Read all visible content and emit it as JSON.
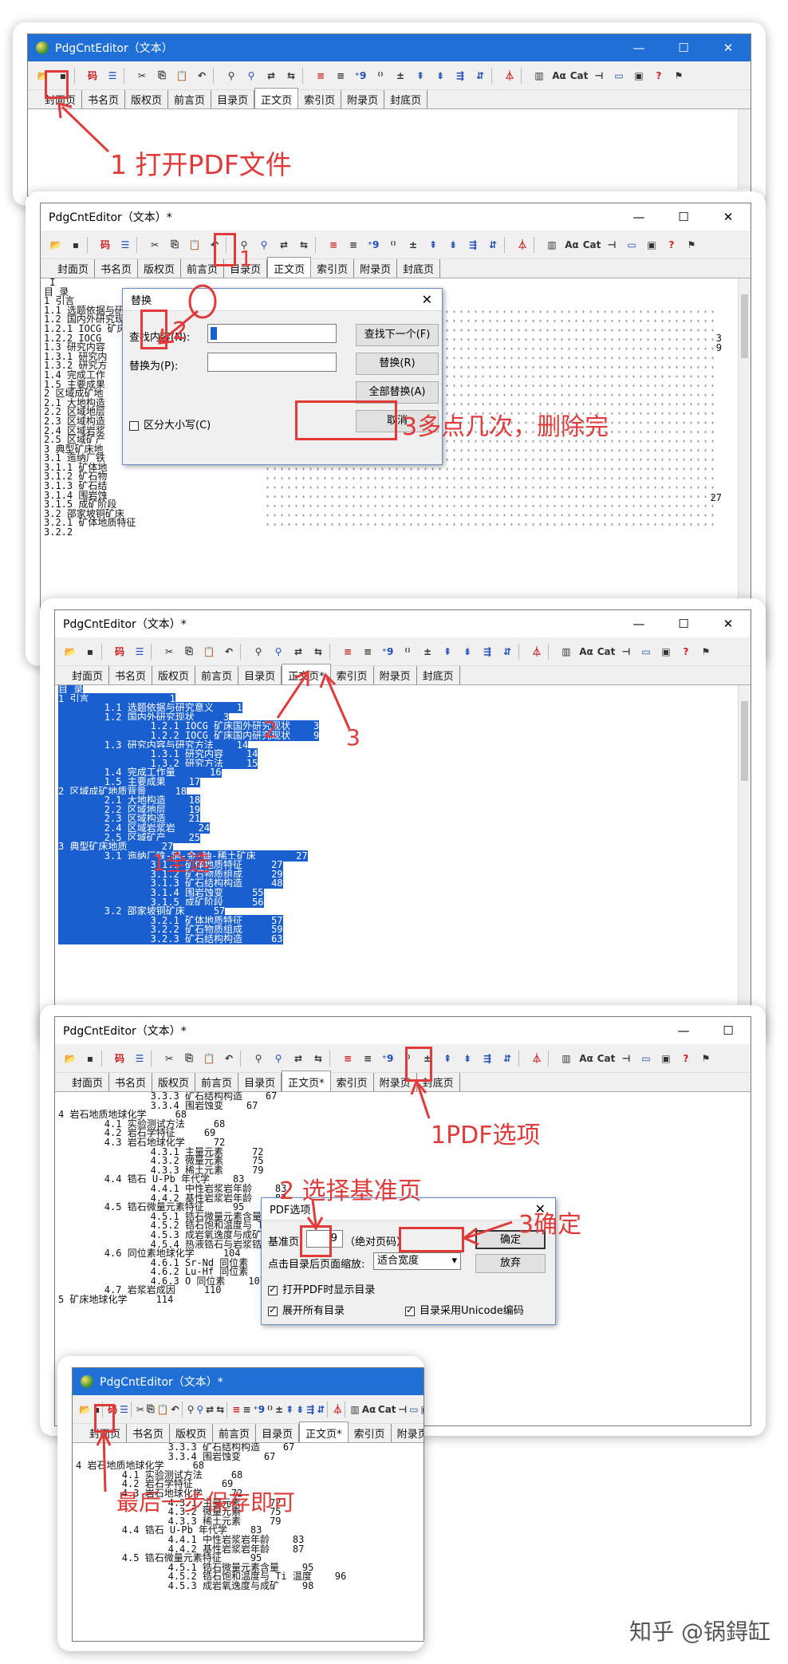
{
  "accent": "#e03a3a",
  "titlebar_blue": "#1f6fd6",
  "selection_blue": "#1a5fd0",
  "window_controls": [
    "—",
    "☐",
    "✕"
  ],
  "tabs": [
    "封面页",
    "书名页",
    "版权页",
    "前言页",
    "目录页",
    "正文页",
    "索引页",
    "附录页",
    "封底页"
  ],
  "tab_body_modified": "正文页*",
  "panel1": {
    "title": "PdgCntEditor（文本）",
    "annotation": "1 打开PDF文件"
  },
  "panel2": {
    "title": "PdgCntEditor（文本）*",
    "annotation1": "1",
    "annotation2": "2",
    "annotation3": "3多点几次，删除完",
    "lines": [
      " I",
      "目 录",
      "1 引言",
      "1.1 选题依据与研究意义 ",
      "1.2 国内外研究现状",
      "1.2.1 IOCG 矿床国外研究现状",
      "1.2.2 IOCG",
      "1.3 研究内容",
      "1.3.1 研究内",
      "1.3.2 研究方",
      "1.4 完成工作",
      "1.5 主要成果",
      "2 区域成矿地",
      "2.1 大地构造",
      "2.2 区域地层",
      "2.3 区域构造",
      "2.4 区域岩浆",
      "2.5 区域矿产",
      "3 典型矿床地",
      "3.1 迤纳厂铁",
      "3.1.1 矿体地",
      "3.1.2 矿石物",
      "3.1.3 矿石结",
      "3.1.4 围岩蚀",
      "3.1.5 成矿阶段",
      "3.2 邵家坡铜矿床",
      "3.2.1 矿体地质特征",
      "3.2.2"
    ],
    "right_numbers": [
      "3",
      "9",
      "27"
    ],
    "dialog": {
      "title": "替换",
      "find_label": "查找内容(N):",
      "find_value": "",
      "replace_label": "替换为(P):",
      "replace_value": "",
      "find_next": "查找下一个(F)",
      "replace": "替换(R)",
      "replace_all": "全部替换(A)",
      "cancel": "取消",
      "match_case": "区分大小写(C)"
    }
  },
  "panel3": {
    "title": "PdgCntEditor（文本）*",
    "annotation_select_all": "1全选",
    "annotation2": "2",
    "annotation3": "3",
    "lines": [
      "目 录",
      "1 引言              1",
      "        1.1 选题依据与研究意义    1",
      "        1.2 国内外研究现状     3",
      "                1.2.1 IOCG 矿床国外研究现状    3",
      "                1.2.2 IOCG 矿床国内研究现状    9",
      "        1.3 研究内容与研究方法    14",
      "                1.3.1 研究内容    14",
      "                1.3.2 研究方法    15",
      "        1.4 完成工作量      16",
      "        1.5 主要成果    17",
      "2 区域成矿地质背景     18",
      "        2.1 大地构造    18",
      "        2.2 区域地层    19",
      "        2.3 区域构造    21",
      "        2.4 区域岩浆岩    24",
      "        2.5 区域矿产    25",
      "3 典型矿床地质      27",
      "        3.1 迤纳厂铁-铜-金-铀-稀土矿床       27",
      "                3.1.1 矿体地质特征     27",
      "                3.1.2 矿石物质组成     29",
      "                3.1.3 矿石结构构造     48",
      "                3.1.4 围岩蚀变     55",
      "                3.1.5 成矿阶段     56",
      "        3.2 邵家坡铜矿床     57",
      "                3.2.1 矿体地质特征     57",
      "                3.2.2 矿石物质组成     59",
      "                3.2.3 矿石结构构造     63"
    ]
  },
  "panel4": {
    "title": "PdgCntEditor（文本）*",
    "annotation1": "1PDF选项",
    "annotation2": "2 选择基准页",
    "annotation3": "3确定",
    "lines": [
      "                3.3.3 矿石结构构造    67",
      "                3.3.4 围岩蚀变    67",
      "4 岩石地质地球化学     68",
      "        4.1 实验测试方法     68",
      "        4.2 岩石学特征     69",
      "        4.3 岩石地球化学     72",
      "                4.3.1 主量元素     72",
      "                4.3.2 微量元素     75",
      "                4.3.3 稀土元素     79",
      "        4.4 锆石 U-Pb 年代学    83",
      "                4.4.1 中性岩浆岩年龄    83",
      "                4.4.2 基性岩浆岩年龄    87",
      "        4.5 锆石微量元素特征     95",
      "                4.5.1 锆石微量元素含量    95",
      "                4.5.2 锆石饱和温度与 Ti 温度    96",
      "                4.5.3 成岩氧逸度与成矿    98",
      "                4.5.4 热液锆石与岩浆锆石    100",
      "        4.6 同位素地球化学     104",
      "                4.6.1 Sr-Nd 同位素    106",
      "                4.6.2 Lu-Hf 同位素    106",
      "                4.6.3 O 同位素    107",
      "        4.7 岩浆岩成因     110",
      "5 矿床地球化学     114"
    ],
    "dialog": {
      "title": "PDF选项",
      "base_page_label": "基准页:",
      "base_page_value": "9",
      "base_page_hint": "（绝对页码）",
      "zoom_label": "点击目录后页面缩放:",
      "zoom_value": "适合宽度",
      "ok": "确定",
      "cancel": "放弃",
      "show_toc": "打开PDF时显示目录",
      "expand_all": "展开所有目录",
      "unicode": "目录采用Unicode编码"
    }
  },
  "panel5": {
    "title": "PdgCntEditor（文本）*",
    "annotation": "最后一步保存即可",
    "lines": [
      "                3.3.3 矿石结构构造    67",
      "                3.3.4 围岩蚀变    67",
      "4 岩石地质地球化学     68",
      "        4.1 实验测试方法     68",
      "        4.2 岩石学特征     69",
      "        4.3 岩石地球化学     72",
      "                4.3.1 主量元素     72",
      "                4.3.2 微量元素     75",
      "                4.3.3 稀土元素     79",
      "        4.4 锆石 U-Pb 年代学    83",
      "                4.4.1 中性岩浆岩年龄    83",
      "                4.4.2 基性岩浆岩年龄    87",
      "        4.5 锆石微量元素特征     95",
      "                4.5.1 锆石微量元素含量    95",
      "                4.5.2 锆石饱和温度与 Ti 温度    96",
      "                4.5.3 成岩氧逸度与成矿    98"
    ]
  },
  "watermark": "知乎 @锅鍀缸"
}
